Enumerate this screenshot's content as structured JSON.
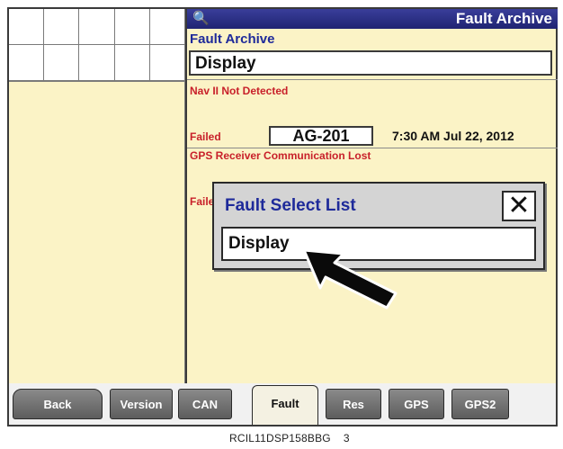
{
  "titlebar": {
    "icon": "magnifier-icon",
    "title": "Fault Archive"
  },
  "main": {
    "heading": "Fault Archive",
    "selected_category": "Display",
    "faults": [
      {
        "message": "Nav II Not Detected"
      },
      {
        "status": "Failed",
        "code": "AG-201",
        "time": "7:30 AM Jul 22, 2012",
        "message": "GPS Receiver Communication Lost"
      },
      {
        "status_partial": "Faile"
      }
    ]
  },
  "popup": {
    "title": "Fault Select List",
    "close_symbol": "✕",
    "selected_item": "Display"
  },
  "tabs": [
    {
      "label": "Back"
    },
    {
      "label": "Version"
    },
    {
      "label": "CAN"
    },
    {
      "label": "Fault",
      "active": true
    },
    {
      "label": "Res"
    },
    {
      "label": "GPS"
    },
    {
      "label": "GPS2"
    }
  ],
  "caption": {
    "figure_id": "RCIL11DSP158BBG",
    "figure_number": "3"
  },
  "colors": {
    "background": "#fbf3c6",
    "titlebar": "#1f2472",
    "heading_blue": "#1e2a9a",
    "fault_red": "#c8202a",
    "tab_gray": "#6e6e6e"
  }
}
